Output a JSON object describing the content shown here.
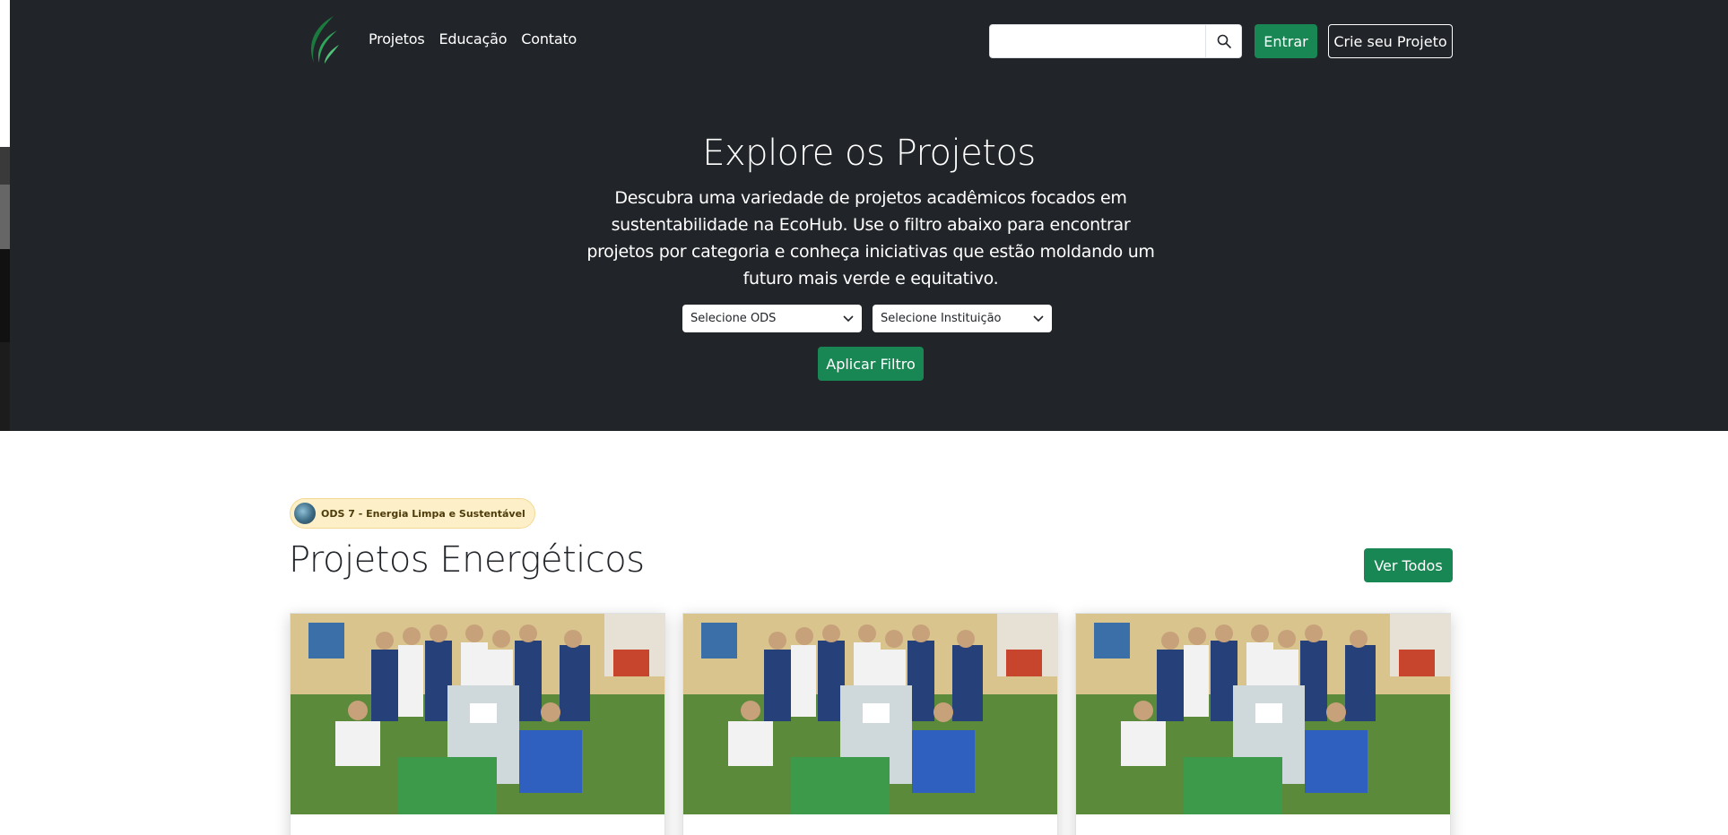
{
  "navbar": {
    "links": [
      "Projetos",
      "Educação",
      "Contato"
    ],
    "search_value": "",
    "entrar_label": "Entrar",
    "crie_label": "Crie seu Projeto"
  },
  "hero": {
    "title": "Explore os Projetos",
    "description": "Descubra uma variedade de projetos acadêmicos focados em sustentabilidade na EcoHub. Use o filtro abaixo para encontrar projetos por categoria e conheça iniciativas que estão moldando um futuro mais verde e equitativo.",
    "filter_ods": "Selecione ODS",
    "filter_instituicao": "Selecione Instituição",
    "apply_label": "Aplicar Filtro"
  },
  "section": {
    "badge": "ODS 7 - Energia Limpa e Sustentável",
    "title": "Projetos Energéticos",
    "ver_todos": "Ver Todos"
  },
  "cards": [
    {
      "title": ""
    },
    {
      "title": ""
    },
    {
      "title": ""
    }
  ],
  "colors": {
    "dark_bg": "#212529",
    "accent_green": "#198754",
    "badge_bg": "#fdf0c8"
  },
  "icons": {
    "logo": "leaf-logo-icon",
    "search": "search-icon",
    "dropdown": "chevron-down-icon",
    "badge": "ods-7-icon"
  }
}
